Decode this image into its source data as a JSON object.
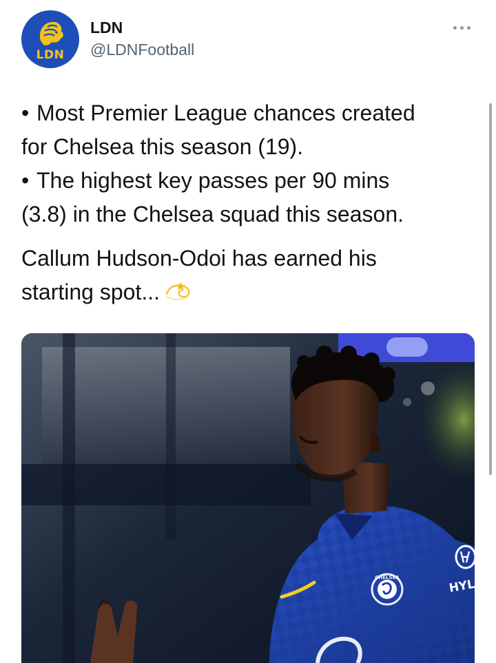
{
  "tweet": {
    "avatar_text": "LDN",
    "display_name": "LDN",
    "handle": "@LDNFootball",
    "lines": [
      {
        "bullet": "•",
        "text": "Most Premier League chances created"
      },
      {
        "bullet": "",
        "text": "for Chelsea this season (19)."
      },
      {
        "bullet": "•",
        "text": "The highest key passes per 90 mins"
      },
      {
        "bullet": "",
        "text": "(3.8) in the Chelsea squad this season."
      }
    ],
    "closing_line1": "Callum Hudson-Odoi has earned his",
    "closing_line2": "starting spot...",
    "closing_emoji": "dizzy-emoji",
    "media": {
      "crest_text": "CHELSEA",
      "sponsor_text": "HYL",
      "description": "Chelsea player in blue kit"
    }
  },
  "colors": {
    "brand_blue": "#1e4fb8",
    "brand_gold": "#f2c21b",
    "secondary_text": "#536471",
    "kit_blue": "#1b3fb0"
  }
}
